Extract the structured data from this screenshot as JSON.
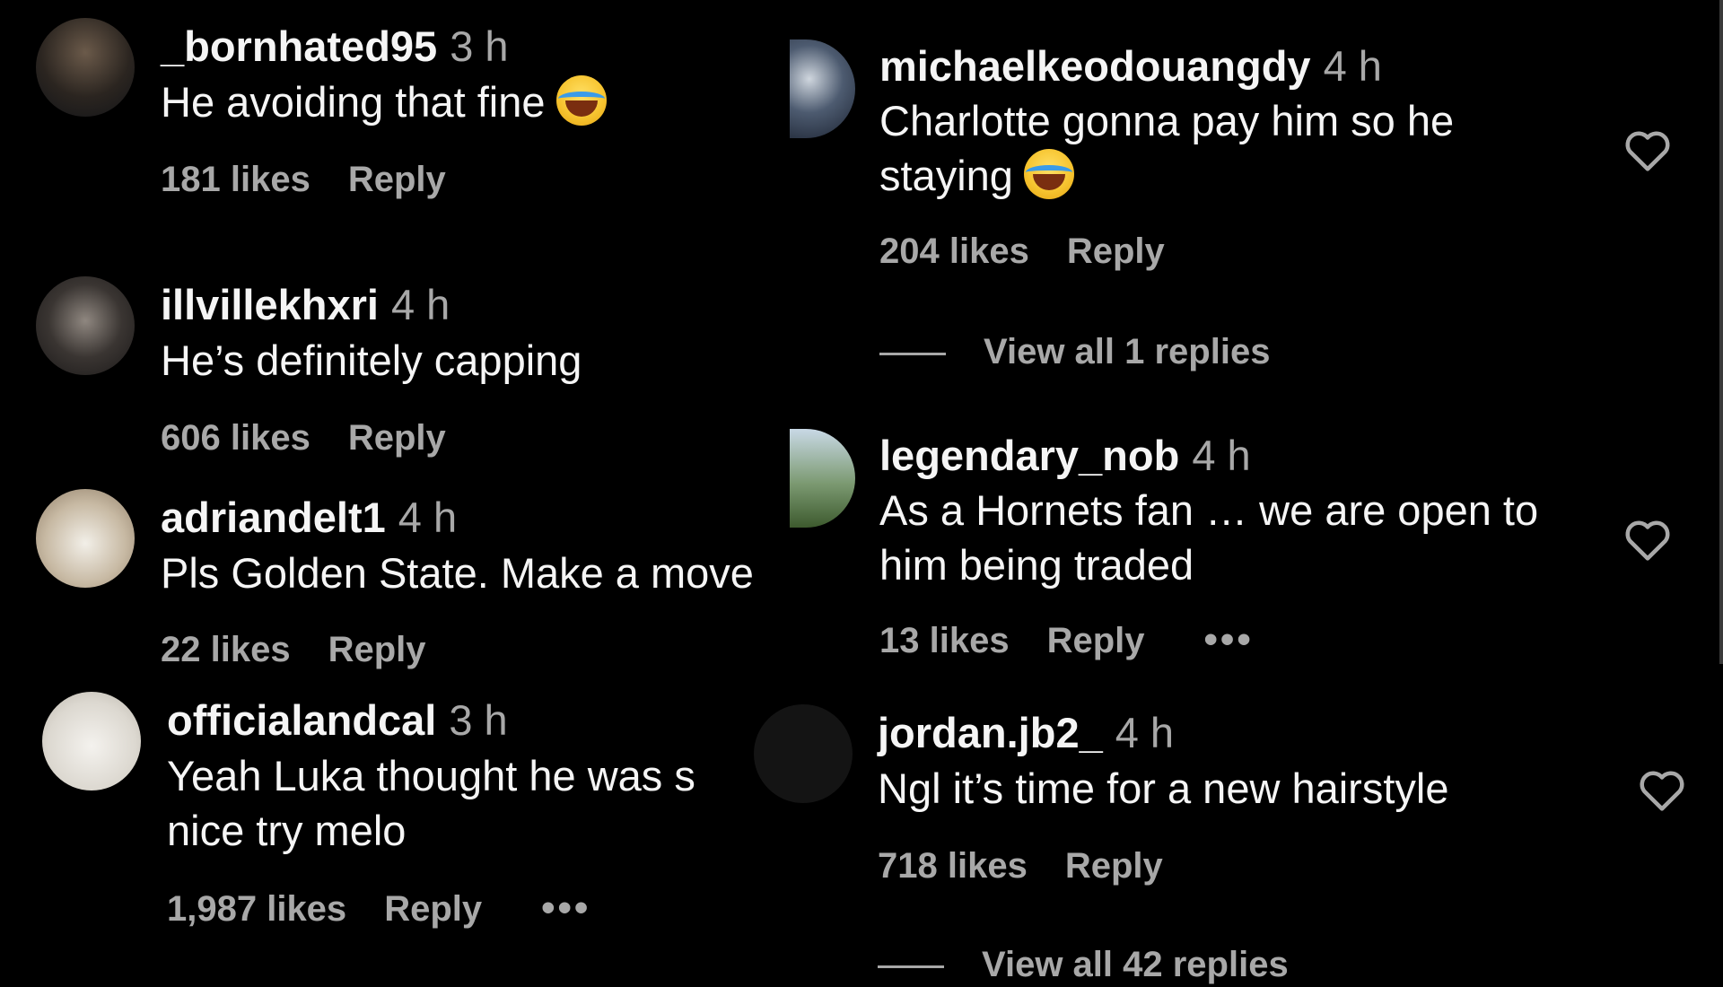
{
  "left_comments": [
    {
      "username": "_bornhated95",
      "time": "3 h",
      "lines": [
        "He avoiding that fine"
      ],
      "emoji": true,
      "likes": "181 likes",
      "reply": "Reply",
      "more": ""
    },
    {
      "username": "illvillekhxri",
      "time": "4 h",
      "lines": [
        "He’s definitely capping"
      ],
      "emoji": false,
      "likes": "606 likes",
      "reply": "Reply",
      "more": ""
    },
    {
      "username": "adriandelt1",
      "time": "4 h",
      "lines": [
        "Pls Golden State. Make a move"
      ],
      "emoji": false,
      "likes": "22 likes",
      "reply": "Reply",
      "more": ""
    },
    {
      "username": "officialandcal",
      "time": "3 h",
      "lines": [
        "Yeah Luka thought he was s",
        "nice try melo"
      ],
      "emoji": false,
      "likes": "1,987 likes",
      "reply": "Reply",
      "more": "•••"
    }
  ],
  "right_comments": [
    {
      "username": "michaelkeodouangdy",
      "time": "4 h",
      "lines": [
        "Charlotte gonna pay him so he",
        "staying"
      ],
      "emoji": true,
      "likes": "204 likes",
      "reply": "Reply",
      "more": ""
    },
    {
      "username": "legendary_nob",
      "time": "4 h",
      "lines": [
        "As a Hornets fan … we are open to",
        "him being traded"
      ],
      "emoji": false,
      "likes": "13 likes",
      "reply": "Reply",
      "more": "•••"
    },
    {
      "username": "jordan.jb2_",
      "time": "4 h",
      "lines": [
        "Ngl it’s time for a new hairstyle"
      ],
      "emoji": false,
      "likes": "718 likes",
      "reply": "Reply",
      "more": ""
    }
  ],
  "view_replies": [
    "View all 1 replies",
    "View all 42 replies"
  ],
  "colors": {
    "background": "#000000",
    "primary_text": "#f5f5f5",
    "secondary_text": "#a8a8a8"
  },
  "icons": {
    "like": "heart-outline-icon",
    "emoji": "face-with-tears-of-joy-icon"
  }
}
